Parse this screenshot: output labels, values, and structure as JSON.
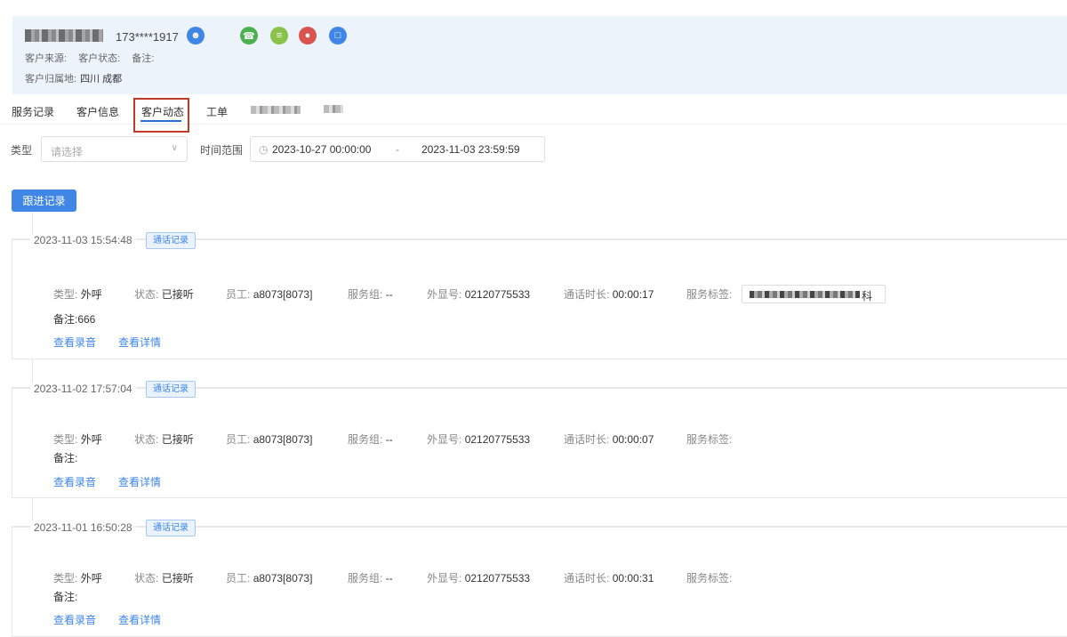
{
  "header": {
    "phone": "173****1917",
    "source_label": "客户来源:",
    "status_label": "客户状态:",
    "remark_label": "备注:",
    "location_label": "客户归属地:",
    "location_value": "四川 成都"
  },
  "tabs": [
    {
      "label": "服务记录"
    },
    {
      "label": "客户信息"
    },
    {
      "label": "客户动态"
    },
    {
      "label": "工单"
    }
  ],
  "filter": {
    "type_label": "类型",
    "type_placeholder": "请选择",
    "range_label": "时间范围",
    "range_start": "2023-10-27 00:00:00",
    "range_sep": "-",
    "range_end": "2023-11-03 23:59:59"
  },
  "follow_button": "跟进记录",
  "records": [
    {
      "time": "2023-11-03 15:54:48",
      "tag": "通话记录",
      "type_k": "类型:",
      "type_v": "外呼",
      "status_k": "状态:",
      "status_v": "已接听",
      "staff_k": "员工:",
      "staff_v": "a8073[8073]",
      "group_k": "服务组:",
      "group_v": "--",
      "display_k": "外显号:",
      "display_v": "02120775533",
      "dur_k": "通话时长:",
      "dur_v": "00:00:17",
      "svc_k": "服务标签:",
      "svc_tag_tail": "科",
      "note": "备注:666",
      "link_audio": "查看录音",
      "link_detail": "查看详情"
    },
    {
      "time": "2023-11-02 17:57:04",
      "tag": "通话记录",
      "type_k": "类型:",
      "type_v": "外呼",
      "status_k": "状态:",
      "status_v": "已接听",
      "staff_k": "员工:",
      "staff_v": "a8073[8073]",
      "group_k": "服务组:",
      "group_v": "--",
      "display_k": "外显号:",
      "display_v": "02120775533",
      "dur_k": "通话时长:",
      "dur_v": "00:00:07",
      "svc_k": "服务标签:",
      "note": "备注:",
      "link_audio": "查看录音",
      "link_detail": "查看详情"
    },
    {
      "time": "2023-11-01 16:50:28",
      "tag": "通话记录",
      "type_k": "类型:",
      "type_v": "外呼",
      "status_k": "状态:",
      "status_v": "已接听",
      "staff_k": "员工:",
      "staff_v": "a8073[8073]",
      "group_k": "服务组:",
      "group_v": "--",
      "display_k": "外显号:",
      "display_v": "02120775533",
      "dur_k": "通话时长:",
      "dur_v": "00:00:31",
      "svc_k": "服务标签:",
      "note": "备注:",
      "link_audio": "查看录音",
      "link_detail": "查看详情"
    }
  ],
  "colors": {
    "accent": "#3f86e6",
    "header_bg": "#ecf3fb",
    "highlight_box": "#c0392b",
    "icon_user": "#3f86e6",
    "icon_call": "#4caf50",
    "icon_message": "#8bc34a",
    "icon_contact": "#d9534f",
    "icon_doc": "#3f86e6"
  }
}
